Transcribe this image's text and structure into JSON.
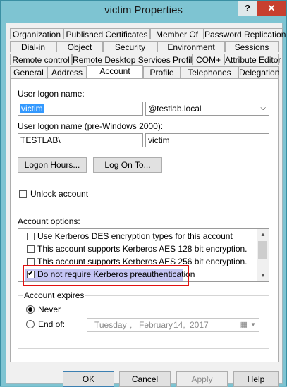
{
  "window": {
    "title": "victim Properties",
    "help_label": "?",
    "close_label": "✕"
  },
  "tabs": {
    "row1": [
      "Organization",
      "Published Certificates",
      "Member Of",
      "Password Replication"
    ],
    "row2": [
      "Dial-in",
      "Object",
      "Security",
      "Environment",
      "Sessions"
    ],
    "row3": [
      "Remote control",
      "Remote Desktop Services Profile",
      "COM+",
      "Attribute Editor"
    ],
    "row4": [
      "General",
      "Address",
      "Account",
      "Profile",
      "Telephones",
      "Delegation"
    ],
    "active": "Account"
  },
  "account": {
    "logon_name_label": "User logon name:",
    "logon_name_value": "victim",
    "domain_value": "@testlab.local",
    "pre2000_label": "User logon name (pre-Windows 2000):",
    "pre2000_domain": "TESTLAB\\",
    "pre2000_name": "victim",
    "logon_hours_button": "Logon Hours...",
    "log_on_to_button": "Log On To...",
    "unlock_label": "Unlock account",
    "unlock_checked": false,
    "options_label": "Account options:",
    "options": [
      {
        "label": "Use Kerberos DES encryption types for this account",
        "checked": false
      },
      {
        "label": "This account supports Kerberos AES 128 bit encryption.",
        "checked": false
      },
      {
        "label": "This account supports Kerberos AES 256 bit encryption.",
        "checked": false
      },
      {
        "label": "Do not require Kerberos preauthentication",
        "checked": true
      }
    ],
    "expires_label": "Account expires",
    "never_label": "Never",
    "end_of_label": "End of:",
    "expires_selected": "Never",
    "date_weekday": "Tuesday",
    "date_sep": ",",
    "date_month": "February",
    "date_day": "14,",
    "date_year": "2017"
  },
  "buttons": {
    "ok": "OK",
    "cancel": "Cancel",
    "apply": "Apply",
    "help": "Help"
  },
  "colors": {
    "highlight_border": "#e01010",
    "selected_option_bg": "#c4c4f4",
    "selection_bg": "#3399ff"
  }
}
